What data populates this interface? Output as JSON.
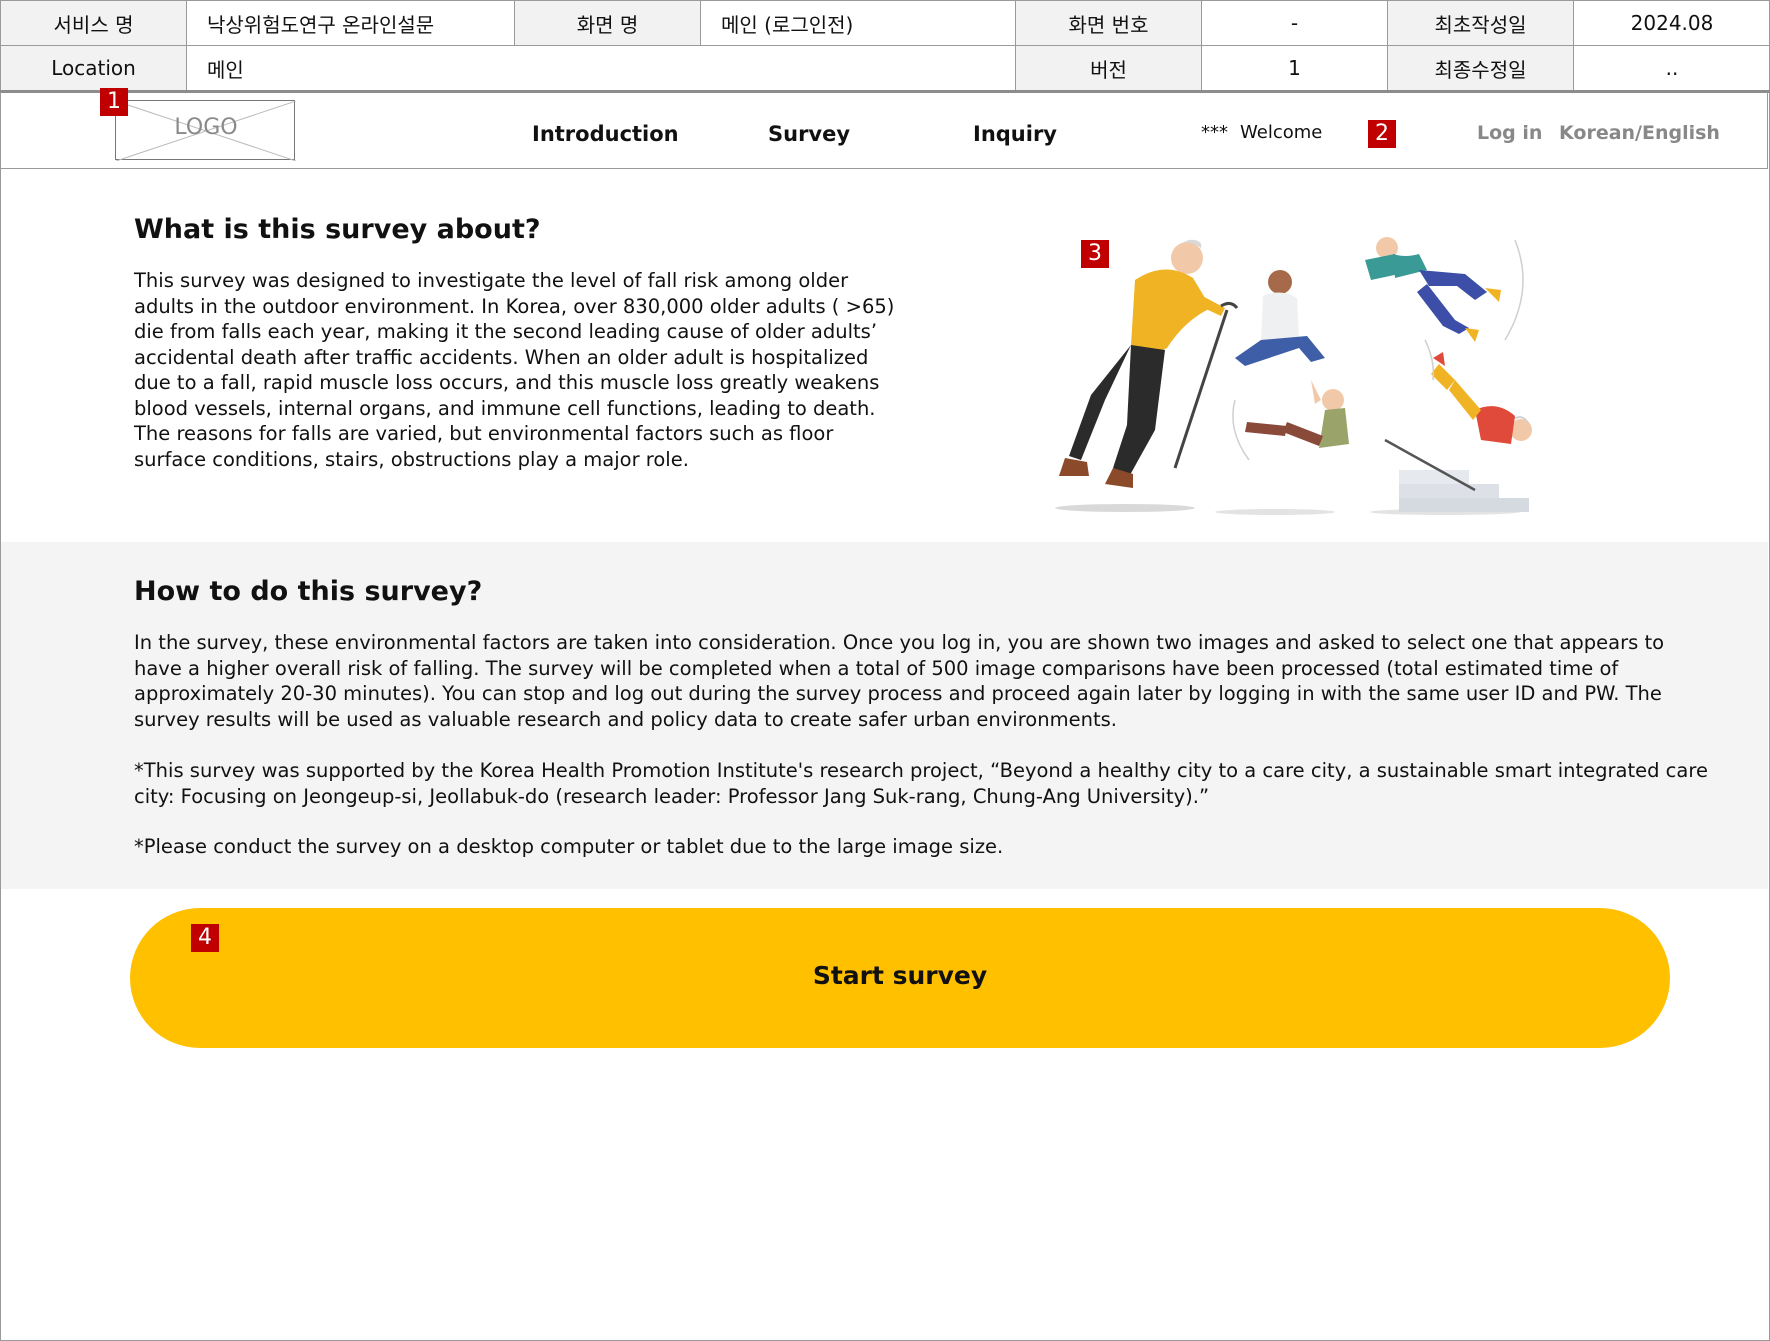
{
  "spec": {
    "service_label": "서비스 명",
    "service_value": "낙상위험도연구 온라인설문",
    "screen_name_label": "화면 명",
    "screen_name_value": "메인 (로그인전)",
    "screen_no_label": "화면 번호",
    "screen_no_value": "-",
    "created_label": "최초작성일",
    "created_value": "2024.08",
    "location_label": "Location",
    "location_value": "메인",
    "version_label": "버전",
    "version_value": "1",
    "modified_label": "최종수정일",
    "modified_value": ".."
  },
  "markers": {
    "m1": "1",
    "m2": "2",
    "m3": "3",
    "m4": "4"
  },
  "header": {
    "logo_text": "LOGO",
    "nav": [
      {
        "label": "Introduction"
      },
      {
        "label": "Survey"
      },
      {
        "label": "Inquiry"
      }
    ],
    "welcome_stars": "***",
    "welcome_text": "Welcome",
    "login_label": "Log in",
    "language_label": "Korean/English"
  },
  "about": {
    "title": "What is this survey about?",
    "lines": [
      "This survey was designed to investigate the level of fall risk among older",
      "adults in the outdoor environment. In Korea, over 830,000 older adults ( >65)",
      "die from falls each year, making it the second leading cause of older adults’",
      "accidental death after traffic accidents. When an older adult is hospitalized",
      "due to a fall, rapid muscle loss occurs, and this muscle loss greatly weakens",
      "blood vessels, internal organs, and immune cell functions, leading to death.",
      "The reasons for falls are varied, but environmental factors such as floor",
      "surface conditions, stairs, obstructions play a major role."
    ]
  },
  "howto": {
    "title": "How to do this survey?",
    "p1_lines": [
      "In the survey, these environmental factors are taken into consideration. Once you log in, you are shown two images and asked to select one that appears to",
      "have a higher overall risk of falling. The survey will be completed when a total of 500 image comparisons have been processed (total estimated time of",
      "approximately 20-30 minutes). You can stop and log out during the survey process and proceed again later by logging in with the same user ID and PW. The",
      "survey results will be used as valuable research and policy data to create safer urban environments."
    ],
    "p2_lines": [
      "*This survey was supported by the Korea Health Promotion Institute's research project, “Beyond a healthy city to a care city, a sustainable smart integrated care",
      "city: Focusing on Jeongeup-si, Jeollabuk-do (research leader: Professor Jang Suk-rang, Chung-Ang University).”"
    ],
    "p3": "*Please conduct the survey on a desktop computer or tablet due to the large image size."
  },
  "start": {
    "label": "Start survey"
  },
  "colors": {
    "accent": "#ffc000",
    "marker": "#c00000"
  }
}
